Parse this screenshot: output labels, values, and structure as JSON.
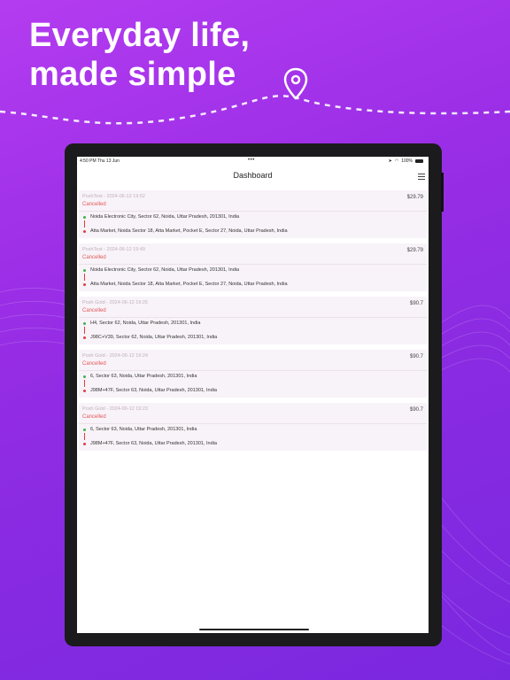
{
  "headline": {
    "line1": "Everyday life,",
    "line2": "made simple"
  },
  "status_bar": {
    "time": "4:50 PM  Thu 13 Jun",
    "dots": "•••",
    "battery": "100%"
  },
  "header": {
    "title": "Dashboard"
  },
  "colors": {
    "accent": "#9a2ee6",
    "cancelled": "#e05a5a",
    "pickup_dot": "#3cb44b",
    "drop_dot": "#e03c3c"
  },
  "rides": [
    {
      "title": "PoshTest - 2024-06-12 19:52",
      "status": "Cancelled",
      "price": "$29.79",
      "pickup": "Noida Electronic City, Sector 62, Noida, Uttar Pradesh, 201301, India",
      "drop": "Atta Market, Noida Sector 18, Atta Market, Pocket E, Sector 27, Noida, Uttar Pradesh, India"
    },
    {
      "title": "PoshTest - 2024-06-12 19:49",
      "status": "Cancelled",
      "price": "$29.79",
      "pickup": "Noida Electronic City, Sector 62, Noida, Uttar Pradesh, 201301, India",
      "drop": "Atta Market, Noida Sector 18, Atta Market, Pocket E, Sector 27, Noida, Uttar Pradesh, India"
    },
    {
      "title": "Posh Gold - 2024-06-12 19:25",
      "status": "Cancelled",
      "price": "$90.7",
      "pickup": "H4, Sector 62, Noida, Uttar Pradesh, 201301, India",
      "drop": "J98C+V39, Sector 62, Noida, Uttar Pradesh, 201301, India"
    },
    {
      "title": "Posh Gold - 2024-06-12 19:24",
      "status": "Cancelled",
      "price": "$90.7",
      "pickup": "6, Sector 63, Noida, Uttar Pradesh, 201301, India",
      "drop": "J98M+47F, Sector 63, Noida, Uttar Pradesh, 201301, India"
    },
    {
      "title": "Posh Gold - 2024-06-12 19:23",
      "status": "Cancelled",
      "price": "$90.7",
      "pickup": "6, Sector 63, Noida, Uttar Pradesh, 201301, India",
      "drop": "J98M+47F, Sector 63, Noida, Uttar Pradesh, 201301, India"
    }
  ]
}
